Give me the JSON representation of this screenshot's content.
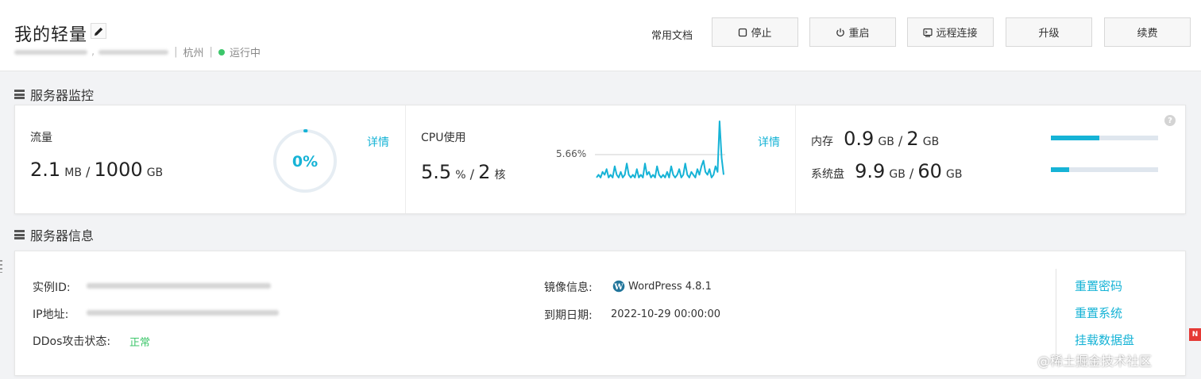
{
  "header": {
    "title": "我的轻量",
    "region": "杭州",
    "status": "运行中",
    "status_color": "#3cc66a",
    "doc_link": "常用文档",
    "buttons": {
      "stop": "停止",
      "restart": "重启",
      "remote": "远程连接",
      "upgrade": "升级",
      "renew": "续费"
    }
  },
  "monitor": {
    "section_title": "服务器监控",
    "traffic": {
      "label": "流量",
      "used": "2.1",
      "used_unit": "MB",
      "total": "1000",
      "total_unit": "GB",
      "percent_text": "0%",
      "percent": 0,
      "detail": "详情"
    },
    "cpu": {
      "label": "CPU使用",
      "value": "5.5",
      "value_unit": "%",
      "cores": "2",
      "cores_unit": "核",
      "chart_label": "5.66%",
      "detail": "详情",
      "sparkline": [
        2,
        3,
        2,
        4,
        3,
        5,
        2,
        3,
        2,
        6,
        3,
        2,
        4,
        2,
        3,
        7,
        3,
        2,
        3,
        2,
        5,
        2,
        3,
        2,
        7,
        3,
        4,
        2,
        3,
        2,
        6,
        3,
        2,
        3,
        2,
        4,
        2,
        6,
        3,
        2,
        3,
        5,
        2,
        3,
        7,
        3,
        2,
        4,
        3,
        2,
        5,
        3,
        6,
        8,
        4,
        3,
        5,
        2,
        3,
        6,
        4,
        22,
        9,
        3
      ]
    },
    "memory": {
      "label": "内存",
      "used": "0.9",
      "used_unit": "GB",
      "total": "2",
      "total_unit": "GB",
      "fill": 0.45
    },
    "disk": {
      "label": "系统盘",
      "used": "9.9",
      "used_unit": "GB",
      "total": "60",
      "total_unit": "GB",
      "fill": 0.17
    },
    "help": "?"
  },
  "info": {
    "section_title": "服务器信息",
    "instance_id_label": "实例ID:",
    "ip_label": "IP地址:",
    "ddos_label": "DDos攻击状态:",
    "ddos_value": "正常",
    "image_label": "镜像信息:",
    "image_value": "WordPress 4.8.1",
    "expiry_label": "到期日期:",
    "expiry_value": "2022-10-29 00:00:00",
    "actions": {
      "reset_password": "重置密码",
      "reset_system": "重置系统",
      "mount_disk": "挂载数据盘"
    }
  },
  "watermark": "@稀土掘金技术社区",
  "corner_badge": "N",
  "colors": {
    "accent": "#16b3d6",
    "ok": "#3cc66a"
  }
}
